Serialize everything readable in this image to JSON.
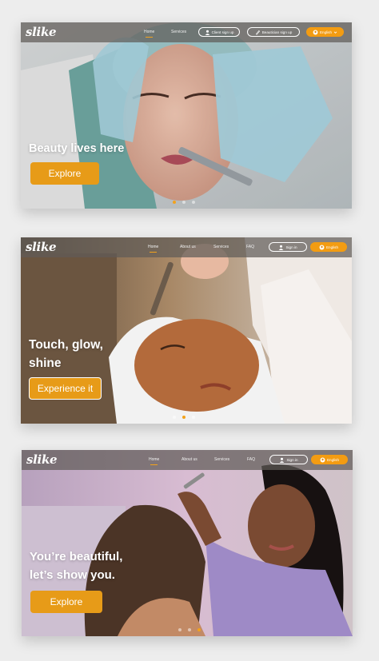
{
  "brand": "slike",
  "accent_color": "#f39c12",
  "screen1": {
    "nav": {
      "links": [
        "Home",
        "Services"
      ],
      "client_signup": "Client sign up",
      "beautician_signup": "Beautician sign up",
      "language": "English"
    },
    "headline": "Beauty lives here",
    "cta": "Explore",
    "slides": {
      "count": 3,
      "active": 1
    }
  },
  "screen2": {
    "nav": {
      "links": [
        "Home",
        "About us",
        "Services",
        "FAQ"
      ],
      "sign_in": "Sign in",
      "language": "English"
    },
    "headline": [
      "Touch, glow,",
      "shine"
    ],
    "cta": "Experience it",
    "slides": {
      "count": 3,
      "active": 2
    }
  },
  "screen3": {
    "nav": {
      "links": [
        "Home",
        "About us",
        "Services",
        "FAQ"
      ],
      "sign_in": "Sign in",
      "language": "English"
    },
    "headline": [
      "You’re beautiful,",
      "let’s show you."
    ],
    "cta": "Explore",
    "slides": {
      "count": 3,
      "active": 3
    }
  },
  "icons": {
    "user": "user-icon",
    "beautician": "brush-icon",
    "globe": "globe-icon",
    "chevron": "chevron-down-icon"
  }
}
